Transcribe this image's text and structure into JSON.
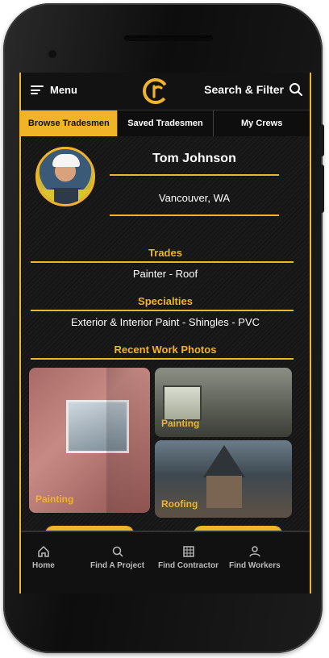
{
  "header": {
    "menu_label": "Menu",
    "search_label": "Search & Filter",
    "logo_letters": "Cr"
  },
  "tabs": [
    {
      "label": "Browse Tradesmen",
      "active": true
    },
    {
      "label": "Saved Tradesmen",
      "active": false
    },
    {
      "label": "My Crews",
      "active": false
    }
  ],
  "profile": {
    "name": "Tom Johnson",
    "location": "Vancouver, WA"
  },
  "trades": {
    "title": "Trades",
    "value": "Painter - Roof"
  },
  "specialties": {
    "title": "Specialties",
    "value": "Exterior & Interior Paint - Shingles - PVC"
  },
  "recent_work": {
    "title": "Recent Work Photos",
    "photos": [
      {
        "caption": "Painting"
      },
      {
        "caption": "Painting"
      },
      {
        "caption": "Roofing"
      }
    ]
  },
  "bottom_nav": [
    {
      "label": "Home",
      "icon": "home-icon"
    },
    {
      "label": "Find A Project",
      "icon": "search-icon"
    },
    {
      "label": "Find Contractor",
      "icon": "building-icon"
    },
    {
      "label": "Find Workers",
      "icon": "user-icon"
    }
  ],
  "colors": {
    "accent": "#f0b429",
    "background": "#1b1b1b"
  }
}
